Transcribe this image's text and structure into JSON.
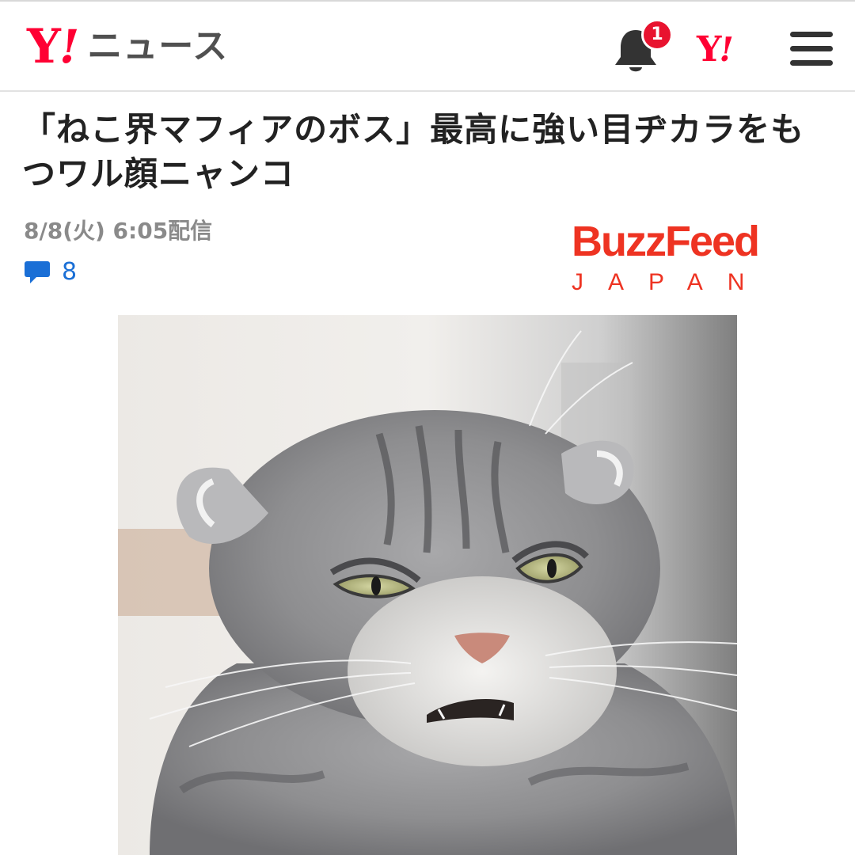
{
  "header": {
    "logo_y": "Y",
    "logo_exclaim": "!",
    "logo_service": "ニュース",
    "notification_count": "1",
    "yahoo_icon_y": "Y",
    "yahoo_icon_exclaim": "!",
    "icons": [
      "bell-icon",
      "yahoo-japan-icon",
      "hamburger-menu-icon"
    ]
  },
  "article": {
    "title": "「ねこ界マフィアのボス」最高に強い目ヂカラをもつワル顔ニャンコ",
    "published": "8/8(火) 6:05配信",
    "comment_count": "8",
    "source": {
      "name": "BuzzFeed",
      "sub": "JAPAN"
    }
  },
  "colors": {
    "yahoo_red": "#ff0033",
    "buzzfeed_red": "#ee3322",
    "comment_blue": "#1a6fd6",
    "badge_red": "#e8132f",
    "text_dark": "#222222",
    "text_gray": "#8a8a8a"
  }
}
